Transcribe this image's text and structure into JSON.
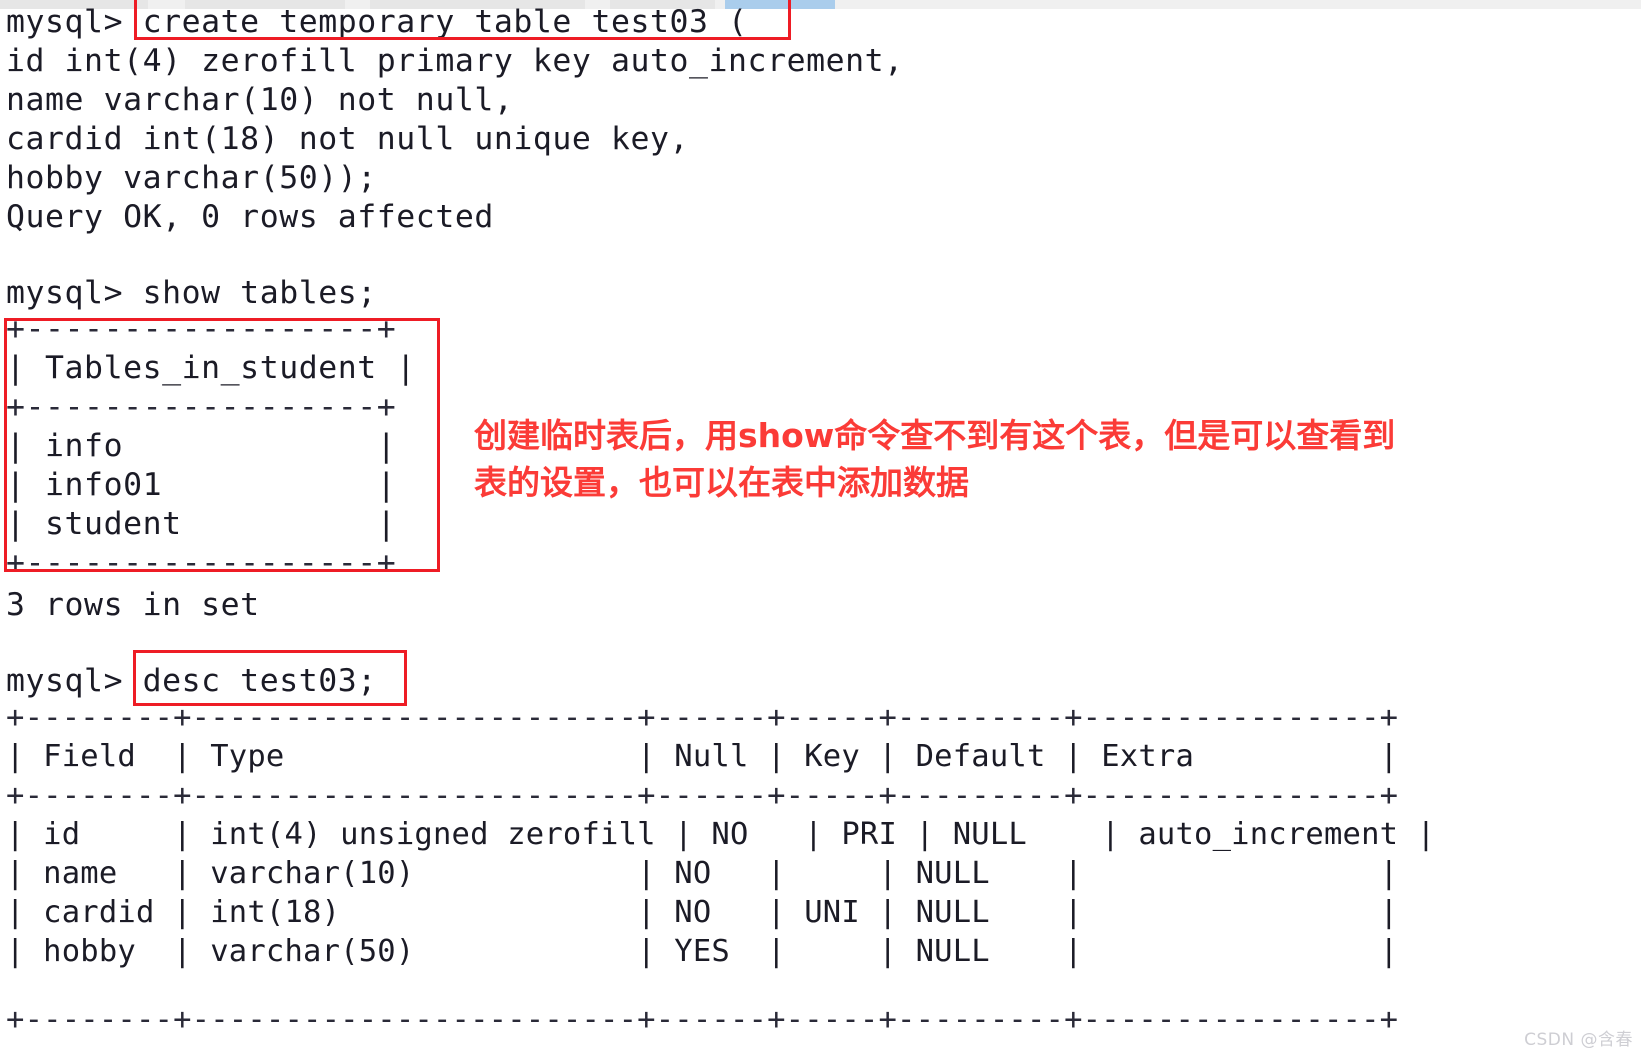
{
  "meta": {
    "background_color": "#ffffff",
    "text_color": "#1b1b26",
    "annotation_color": "#fb3b37",
    "box_color": "#ee1c25",
    "watermark_color": "#c9c9cf"
  },
  "terminal": {
    "prompt": "mysql>",
    "lines": [
      {
        "id": "l01",
        "text": "mysql> create temporary table test03 ("
      },
      {
        "id": "l02",
        "text": "id int(4) zerofill primary key auto_increment,"
      },
      {
        "id": "l03",
        "text": "name varchar(10) not null,"
      },
      {
        "id": "l04",
        "text": "cardid int(18) not null unique key,"
      },
      {
        "id": "l05",
        "text": "hobby varchar(50));"
      },
      {
        "id": "l06",
        "text": "Query OK, 0 rows affected"
      },
      {
        "id": "l07",
        "text": ""
      },
      {
        "id": "l08",
        "text": "mysql> show tables;"
      },
      {
        "id": "l09",
        "text": "+------------------+"
      },
      {
        "id": "l10",
        "text": "| Tables_in_student |"
      },
      {
        "id": "l11",
        "text": "+------------------+"
      },
      {
        "id": "l12",
        "text": "| info             |"
      },
      {
        "id": "l13",
        "text": "| info01           |"
      },
      {
        "id": "l14",
        "text": "| student          |"
      },
      {
        "id": "l15",
        "text": "+------------------+"
      },
      {
        "id": "l16",
        "text": "3 rows in set"
      },
      {
        "id": "l17",
        "text": ""
      },
      {
        "id": "l18",
        "text": "mysql> desc test03;"
      },
      {
        "id": "l19",
        "text": "+--------+------------------------+------+-----+---------+----------------+"
      },
      {
        "id": "l20",
        "text": "| Field  | Type                   | Null | Key | Default | Extra          |"
      },
      {
        "id": "l21",
        "text": "+--------+------------------------+------+-----+---------+----------------+"
      },
      {
        "id": "l22",
        "text": "| id     | int(4) unsigned zerofill | NO   | PRI | NULL    | auto_increment |"
      },
      {
        "id": "l23",
        "text": "| name   | varchar(10)            | NO   |     | NULL    |                |"
      },
      {
        "id": "l24",
        "text": "| cardid | int(18)                | NO   | UNI | NULL    |                |"
      },
      {
        "id": "l25",
        "text": "| hobby  | varchar(50)            | YES  |     | NULL    |                |"
      },
      {
        "id": "l26",
        "text": "+--------+------------------------+------+-----+---------+----------------+"
      }
    ],
    "commands": [
      {
        "id": "cmd-create",
        "text": "create temporary table test03 ("
      },
      {
        "id": "cmd-show",
        "text": "show tables;"
      },
      {
        "id": "cmd-desc",
        "text": "desc test03;"
      }
    ],
    "status_messages": [
      "Query OK, 0 rows affected",
      "3 rows in set"
    ]
  },
  "show_tables_result": {
    "column_header": "Tables_in_student",
    "rows": [
      "info",
      "info01",
      "student"
    ],
    "row_count_text": "3 rows in set"
  },
  "desc_result": {
    "headers": [
      "Field",
      "Type",
      "Null",
      "Key",
      "Default",
      "Extra"
    ],
    "rows": [
      {
        "Field": "id",
        "Type": "int(4) unsigned zerofill",
        "Null": "NO",
        "Key": "PRI",
        "Default": "NULL",
        "Extra": "auto_increment"
      },
      {
        "Field": "name",
        "Type": "varchar(10)",
        "Null": "NO",
        "Key": "",
        "Default": "NULL",
        "Extra": ""
      },
      {
        "Field": "cardid",
        "Type": "int(18)",
        "Null": "NO",
        "Key": "UNI",
        "Default": "NULL",
        "Extra": ""
      },
      {
        "Field": "hobby",
        "Type": "varchar(50)",
        "Null": "YES",
        "Key": "",
        "Default": "NULL",
        "Extra": ""
      }
    ]
  },
  "annotation": {
    "text": "创建临时表后，用show命令查不到有这个表，但是可以查看到\n表的设置，也可以在表中添加数据"
  },
  "watermark": {
    "text": "CSDN @含春"
  }
}
